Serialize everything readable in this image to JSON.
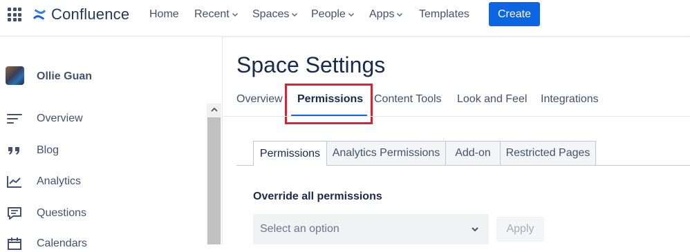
{
  "topnav": {
    "brand": "Confluence",
    "items": [
      {
        "label": "Home",
        "dropdown": false
      },
      {
        "label": "Recent",
        "dropdown": true
      },
      {
        "label": "Spaces",
        "dropdown": true
      },
      {
        "label": "People",
        "dropdown": true
      },
      {
        "label": "Apps",
        "dropdown": true
      },
      {
        "label": "Templates",
        "dropdown": false
      }
    ],
    "create_label": "Create"
  },
  "sidebar": {
    "space_name": "Ollie Guan",
    "items": [
      {
        "label": "Overview",
        "icon": "overview-lines-icon"
      },
      {
        "label": "Blog",
        "icon": "quote-icon"
      },
      {
        "label": "Analytics",
        "icon": "analytics-chart-icon"
      },
      {
        "label": "Questions",
        "icon": "question-chat-icon"
      },
      {
        "label": "Calendars",
        "icon": "calendar-icon"
      }
    ]
  },
  "main": {
    "title": "Space Settings",
    "tabs": [
      "Overview",
      "Permissions",
      "Content Tools",
      "Look and Feel",
      "Integrations"
    ],
    "active_tab": "Permissions",
    "subtabs": [
      "Permissions",
      "Analytics Permissions",
      "Add-on",
      "Restricted Pages"
    ],
    "active_subtab": "Permissions",
    "override_label": "Override all permissions",
    "select_placeholder": "Select an option",
    "apply_label": "Apply"
  },
  "colors": {
    "accent": "#0c66e4",
    "highlight_box": "#e02030",
    "text_primary": "#172b4d",
    "text_secondary": "#42526e"
  }
}
